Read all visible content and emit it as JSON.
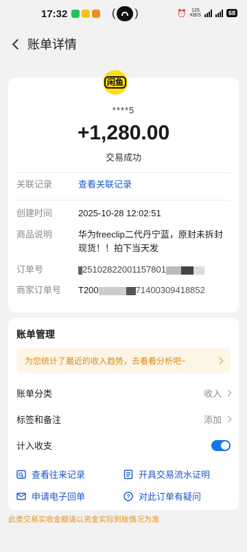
{
  "status_bar": {
    "time": "17:32",
    "center_left": "(",
    "center_right": ")",
    "net_speed_top": "125",
    "net_speed_bottom": "KB/S",
    "battery": "68"
  },
  "header": {
    "title": "账单详情"
  },
  "summary": {
    "logo_text": "闲鱼",
    "account": "****5",
    "amount": "+1,280.00",
    "status": "交易成功"
  },
  "details": [
    {
      "label": "关联记录",
      "value": "查看关联记录",
      "is_link": true
    },
    {
      "label": "创建时间",
      "value": "2025-10-28 12:02:51"
    },
    {
      "label": "商品说明",
      "value": "华为freeclip二代丹宁蓝，原封未拆封现货！！拍下当天发"
    },
    {
      "label": "订单号",
      "value": "25102822001157801"
    },
    {
      "label": "商家订单号",
      "value": "T200",
      "value_tail": "71400309418852"
    }
  ],
  "management": {
    "title": "账单管理",
    "tip": "为您统计了最近的收入趋势，去看看分析吧~",
    "category_label": "账单分类",
    "category_value": "收入",
    "tags_label": "标签和备注",
    "tags_value": "添加",
    "count_label": "计入收支",
    "count_enabled": true,
    "actions": [
      {
        "label": "查看往来记录",
        "icon": "record-icon"
      },
      {
        "label": "开具交易流水证明",
        "icon": "certificate-icon"
      },
      {
        "label": "申请电子回单",
        "icon": "mail-icon"
      },
      {
        "label": "对此订单有疑问",
        "icon": "question-icon"
      }
    ]
  },
  "footnote": "此类交易实收金额请以资金实际到账情况为准"
}
